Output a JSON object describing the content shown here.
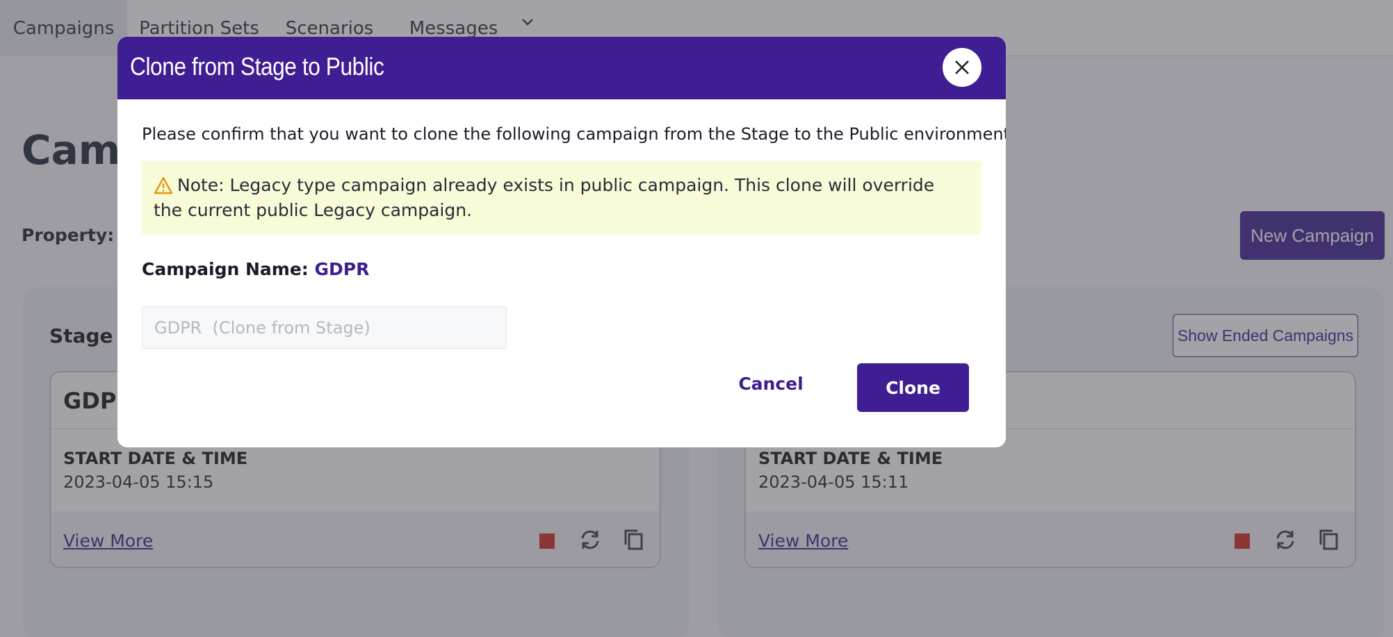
{
  "nav": {
    "tabs": [
      {
        "label": "Campaigns"
      },
      {
        "label": "Partition Sets"
      },
      {
        "label": "Scenarios"
      },
      {
        "label": "Messages"
      }
    ]
  },
  "page": {
    "title": "Camp",
    "property_label": "Property: to",
    "new_campaign_label": "New Campaign",
    "stage_panel_title": "Stage C",
    "show_ended_label": "Show Ended Campaigns",
    "cards": [
      {
        "name": "GDPR",
        "start_label": "START DATE & TIME",
        "start_value": "2023-04-05 15:15",
        "view_more": "View More"
      },
      {
        "name": "",
        "start_label": "START DATE & TIME",
        "start_value": "2023-04-05 15:11",
        "view_more": "View More"
      }
    ]
  },
  "modal": {
    "title": "Clone from Stage to Public",
    "message": "Please confirm that you want to clone the following campaign from the Stage to the Public environment.",
    "note": "Note: Legacy type campaign already exists in public campaign. This clone will override the current public Legacy campaign.",
    "campaign_name_label": "Campaign Name:",
    "campaign_name_value": "GDPR",
    "name_input_placeholder": "GDPR  (Clone from Stage)",
    "cancel_label": "Cancel",
    "clone_label": "Clone"
  },
  "colors": {
    "brand": "#3f1d92",
    "note_bg": "#f8fbd8",
    "warning": "#e8940c",
    "stop": "#d0241b"
  }
}
